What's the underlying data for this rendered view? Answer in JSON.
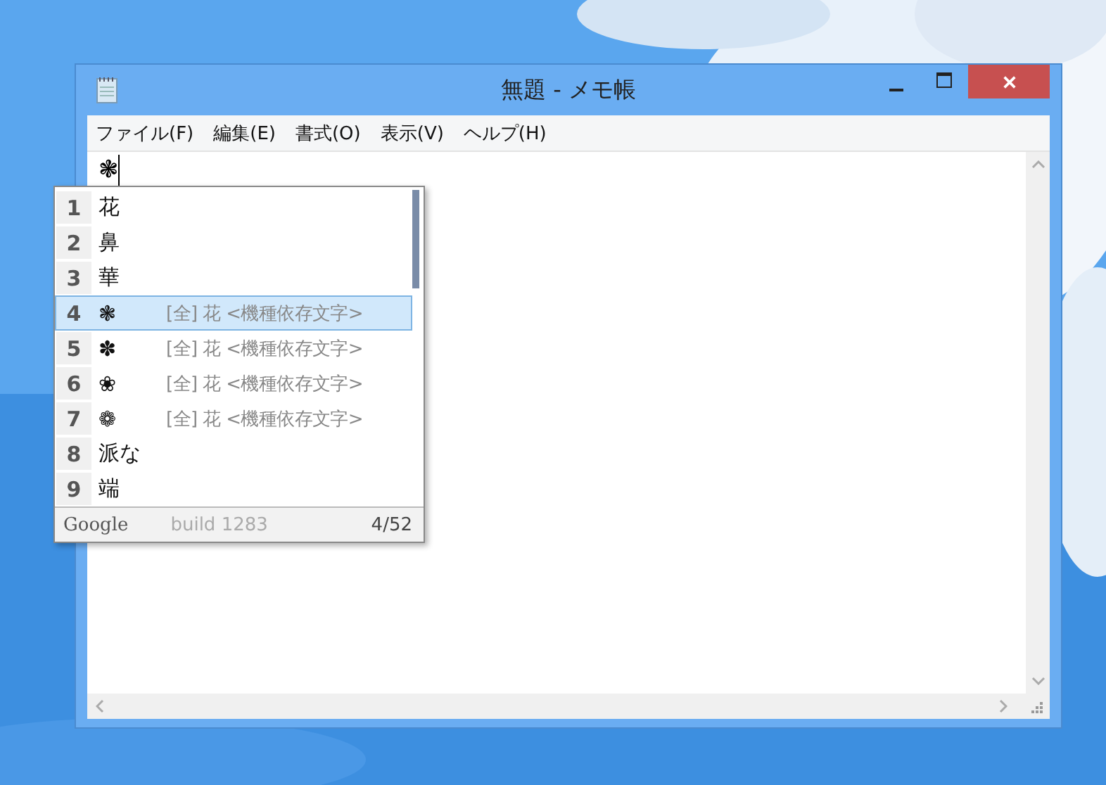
{
  "window": {
    "title": "無題 - メモ帳"
  },
  "menu": [
    "ファイル(F)",
    "編集(E)",
    "書式(O)",
    "表示(V)",
    "ヘルプ(H)"
  ],
  "editor": {
    "composition": "❃"
  },
  "candidates": [
    {
      "number": "1",
      "text": "花",
      "selected": false
    },
    {
      "number": "2",
      "text": "鼻",
      "selected": false
    },
    {
      "number": "3",
      "text": "華",
      "selected": false
    },
    {
      "number": "4",
      "text": "❃",
      "description": "[全] 花 <機種依存文字>",
      "selected": true
    },
    {
      "number": "5",
      "text": "✽",
      "description": "[全] 花 <機種依存文字>",
      "selected": false
    },
    {
      "number": "6",
      "text": "❀",
      "description": "[全] 花 <機種依存文字>",
      "selected": false
    },
    {
      "number": "7",
      "text": "❁",
      "description": "[全] 花 <機種依存文字>",
      "selected": false
    },
    {
      "number": "8",
      "text": "派な",
      "selected": false
    },
    {
      "number": "9",
      "text": "端",
      "selected": false
    }
  ],
  "footer": {
    "brand": "Google",
    "build": "build 1283",
    "position": "4/52"
  }
}
